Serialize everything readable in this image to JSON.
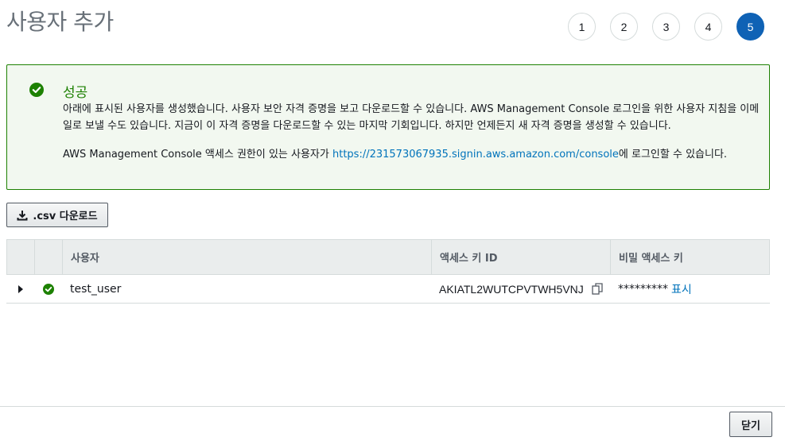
{
  "page": {
    "title": "사용자 추가"
  },
  "steps": [
    "1",
    "2",
    "3",
    "4",
    "5"
  ],
  "active_step": "5",
  "colors": {
    "success": "#1d8102",
    "primary": "#0f62b5",
    "link": "#0073bb"
  },
  "alert": {
    "icon": "check-circle-icon",
    "title": "성공",
    "line1": "아래에 표시된 사용자를 생성했습니다. 사용자 보안 자격 증명을 보고 다운로드할 수 있습니다. AWS Management Console 로그인을 위한 사용자 지침을 이메일로 보낼 수도 있습니다. 지금이 이 자격 증명을 다운로드할 수 있는 마지막 기회입니다. 하지만 언제든지 새 자격 증명을 생성할 수 있습니다.",
    "line2_prefix": "AWS Management Console 액세스 권한이 있는 사용자가 ",
    "line2_link": "https://231573067935.signin.aws.amazon.com/console",
    "line2_suffix": "에 로그인할 수 있습니다."
  },
  "csv_button": {
    "label": ".csv 다운로드",
    "icon": "download-icon"
  },
  "table": {
    "headers": {
      "user": "사용자",
      "access_key": "액세스 키 ID",
      "secret_key": "비밀 액세스 키"
    },
    "rows": [
      {
        "user": "test_user",
        "access_key": "AKIATL2WUTCPVTWH5VNJ",
        "secret_masked": "*********",
        "show_label": "표시"
      }
    ]
  },
  "footer": {
    "close_label": "닫기"
  }
}
